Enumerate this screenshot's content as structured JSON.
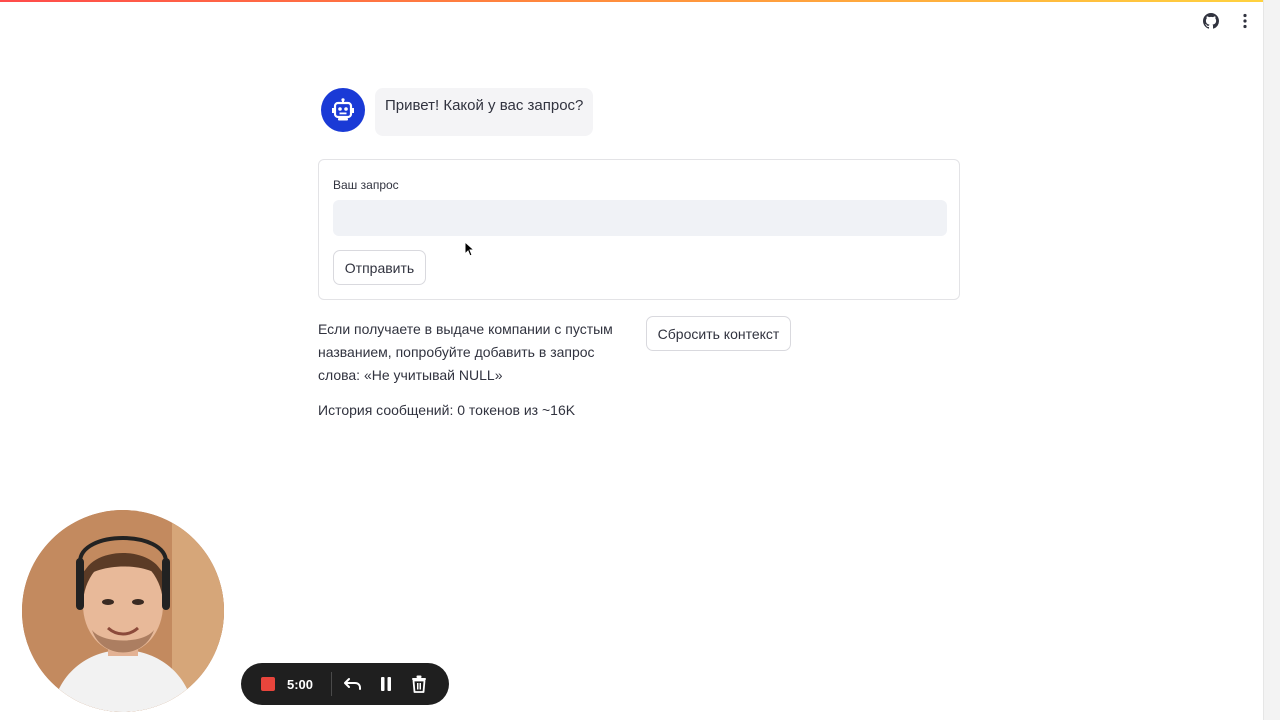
{
  "header": {
    "github_icon": "github-icon",
    "menu_icon": "kebab-menu-icon"
  },
  "chat": {
    "avatar_icon": "robot-icon",
    "assistant_message": "Привет! Какой у вас запрос?"
  },
  "form": {
    "input_label": "Ваш запрос",
    "input_value": "",
    "input_placeholder": "",
    "submit_label": "Отправить"
  },
  "hint": {
    "text": "Если получаете в выдаче компании с пустым названием, попробуйте добавить в запрос слова: «Не учитывай NULL»"
  },
  "reset": {
    "label": "Сбросить контекст"
  },
  "history": {
    "text": "История сообщений: 0 токенов из ~16K"
  },
  "recorder": {
    "time": "5:00",
    "stop_icon": "stop-icon",
    "undo_icon": "undo-icon",
    "pause_icon": "pause-icon",
    "delete_icon": "trash-icon"
  },
  "colors": {
    "avatar_bg": "#1a3ad6",
    "input_bg": "#f0f2f6",
    "recorder_bg": "#1f1f1f",
    "record_red": "#e8453c"
  }
}
